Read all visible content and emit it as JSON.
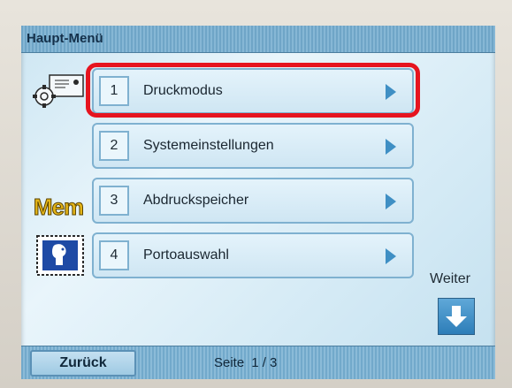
{
  "header": {
    "title": "Haupt-Menü"
  },
  "side_icons": {
    "settings": "settings-gear-icon",
    "memory": "Mem",
    "stamp": "stamp-icon"
  },
  "menu": {
    "items": [
      {
        "number": "1",
        "label": "Druckmodus",
        "selected": true
      },
      {
        "number": "2",
        "label": "Systemeinstellungen",
        "selected": false
      },
      {
        "number": "3",
        "label": "Abdruckspeicher",
        "selected": false
      },
      {
        "number": "4",
        "label": "Portoauswahl",
        "selected": false
      }
    ]
  },
  "navigation": {
    "next_label": "Weiter",
    "back_label": "Zurück",
    "page_label": "Seite",
    "page_value": "1 / 3"
  },
  "colors": {
    "highlight": "#e6141f",
    "header_bar": "#6fa5c7",
    "arrow": "#3f8fc4",
    "mem_gold": "#e3b418"
  }
}
